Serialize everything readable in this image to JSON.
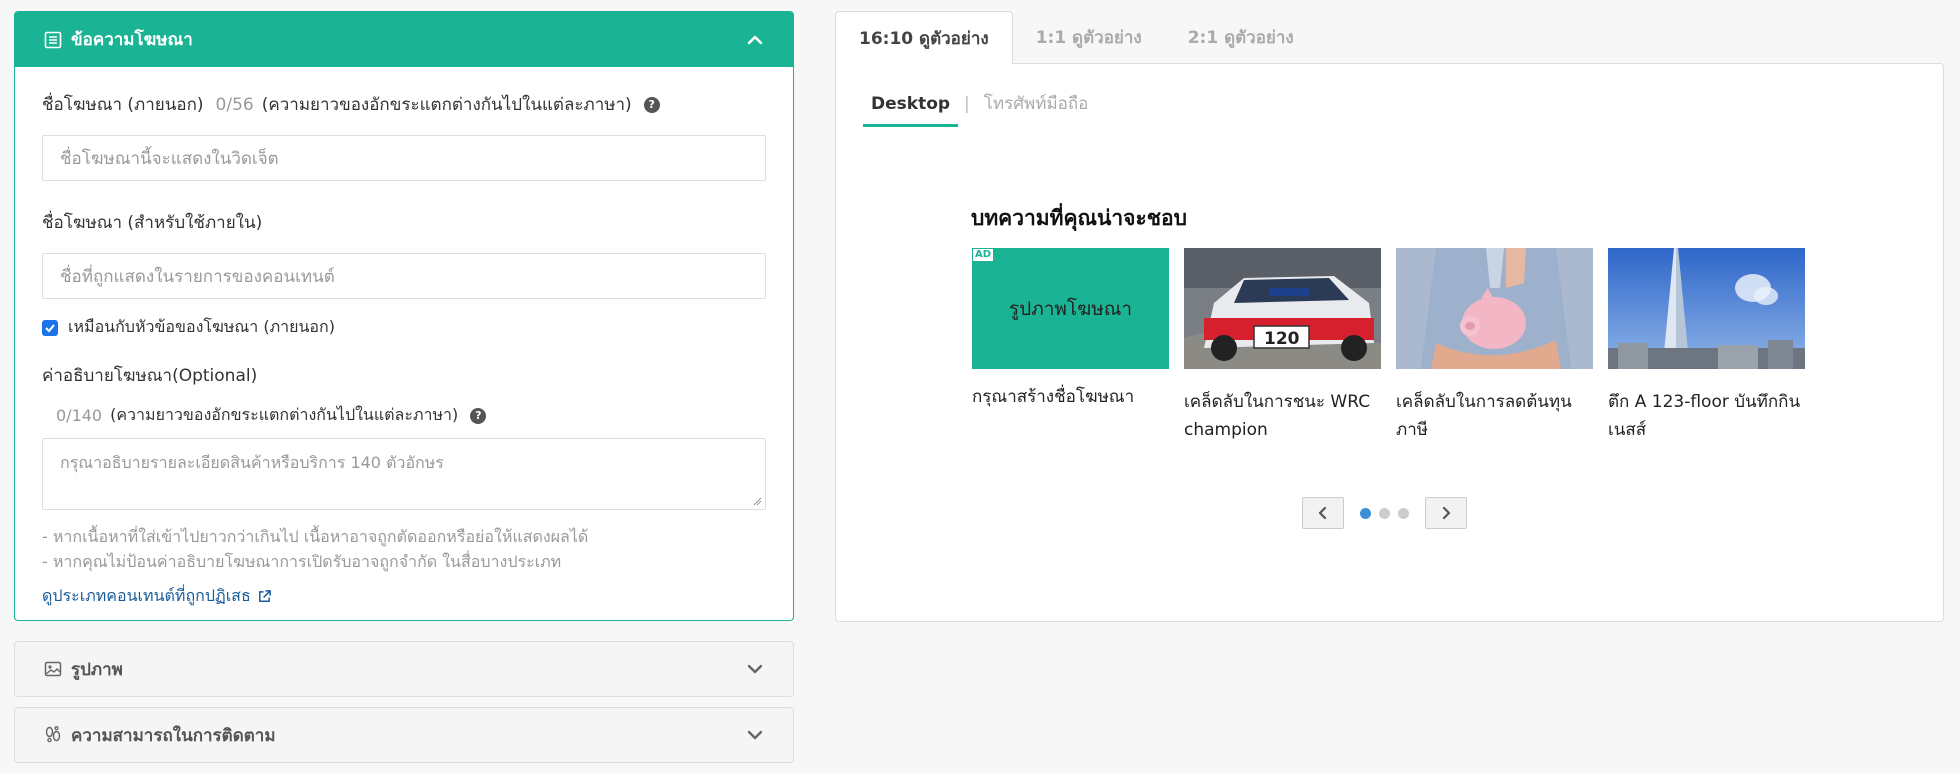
{
  "ad_text_panel": {
    "title": "ข้อความโฆษณา",
    "external_name": {
      "label": "ชื่อโฆษณา (ภายนอก)",
      "counter": "0/56",
      "hint": "(ความยาวของอักขระแตกต่างกันไปในแต่ละภาษา)",
      "placeholder": "ชื่อโฆษณานี้จะแสดงในวิดเจ็ต"
    },
    "internal_name": {
      "label": "ชื่อโฆษณา (สำหรับใช้ภายใน)",
      "placeholder": "ชื่อที่ถูกแสดงในรายการของคอนเทนต์"
    },
    "same_as_checkbox": {
      "label": "เหมือนกับหัวข้อของโฆษณา (ภายนอก)",
      "checked": true
    },
    "description": {
      "label": "ค่าอธิบายโฆษณา",
      "optional": "(Optional)",
      "counter": "0/140",
      "hint": "(ความยาวของอักขระแตกต่างกันไปในแต่ละภาษา)",
      "placeholder": "กรุณาอธิบายรายละเอียดสินค้าหรือบริการ 140 ตัวอักษร"
    },
    "notes": [
      "- หากเนื้อหาที่ใส่เข้าไปยาวกว่าเกินไป เนื้อหาอาจถูกตัดออกหรือย่อให้แสดงผลได้",
      "- หากคุณไม่ป้อนค่าอธิบายโฆษณาการเปิดรับอาจถูกจำกัด ในสื่อบางประเภท"
    ],
    "rejected_link": "ดูประเภทคอนเทนต์ที่ถูกปฏิเสธ"
  },
  "image_panel": {
    "title": "รูปภาพ"
  },
  "tracking_panel": {
    "title": "ความสามารถในการติดตาม"
  },
  "preview": {
    "tabs": [
      "16:10 ดูตัวอย่าง",
      "1:1 ดูตัวอย่าง",
      "2:1 ดูตัวอย่าง"
    ],
    "active_tab": 0,
    "device_tabs": [
      "Desktop",
      "โทรศัพท์มือถือ"
    ],
    "device_separator": "|",
    "widget_title": "บทความที่คุณน่าจะชอบ",
    "cards": [
      {
        "badge": "AD",
        "image_text": "รูปภาพโฆษณา",
        "title": "กรุณาสร้างชื่อโฆษณา"
      },
      {
        "image": "rally-car",
        "title": "เคล็ดลับในการชนะ WRC champion"
      },
      {
        "image": "piggy-bank",
        "title": "เคล็ดลับในการลดต้นทุนภาษี"
      },
      {
        "image": "skyscraper",
        "title": "ตึก A 123-floor บันทึกกินเนสส์"
      }
    ],
    "pager": {
      "pages": 3,
      "current": 1
    }
  },
  "colors": {
    "accent": "#1ab394",
    "link": "#1a5c9a",
    "dot_active": "#3a8fd8"
  }
}
